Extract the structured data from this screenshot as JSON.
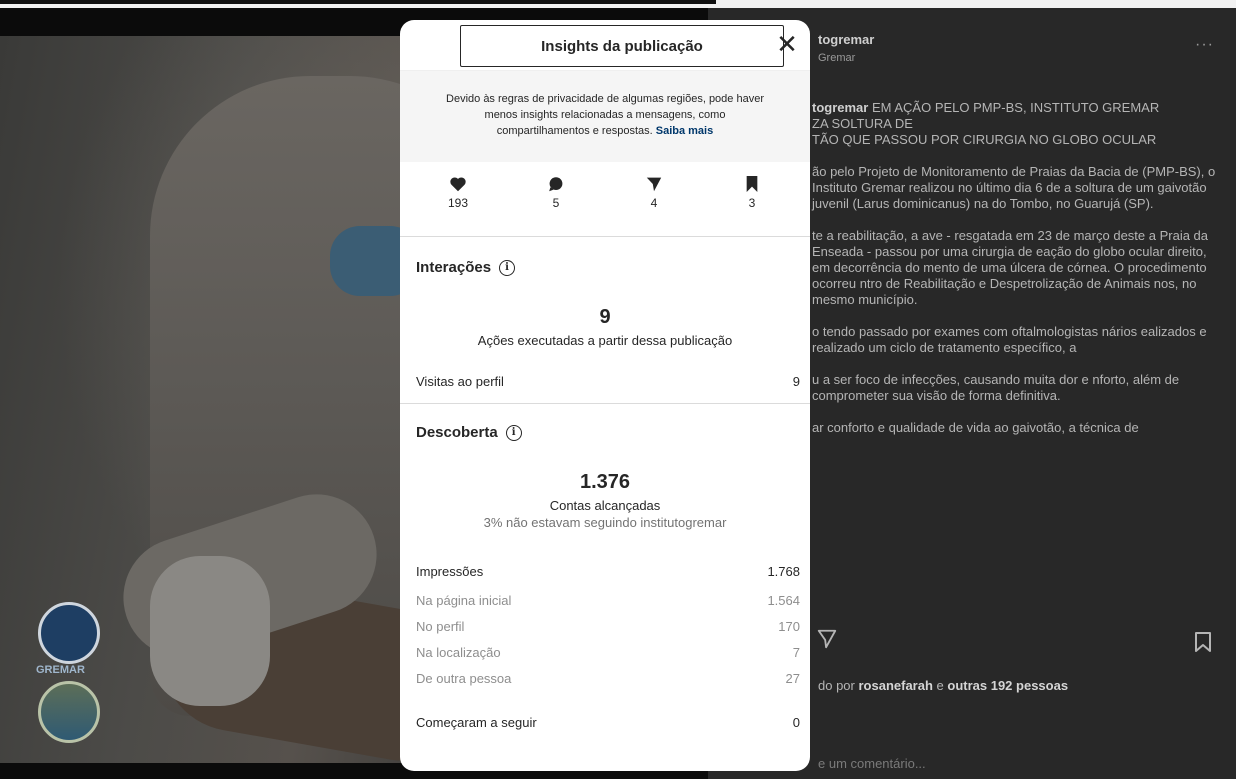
{
  "post": {
    "account": "togremar",
    "subtitle": "Gremar",
    "more_label": "···",
    "caption": {
      "p1_user": "togremar",
      "p1_text": " EM AÇÃO PELO PMP-BS, INSTITUTO GREMAR",
      "p1_l2": "ZA SOLTURA DE",
      "p1_l3": "TÃO QUE PASSOU POR CIRURGIA NO GLOBO OCULAR",
      "p2": "ão pelo Projeto de Monitoramento de Praias da Bacia de (PMP-BS), o Instituto Gremar realizou no último dia 6 de a soltura de um gaivotão juvenil (Larus dominicanus) na do Tombo, no Guarujá (SP).",
      "p3": "te a reabilitação, a ave - resgatada em 23 de março deste a Praia da Enseada - passou por uma cirurgia de eação do globo ocular direito, em decorrência do mento de uma úlcera de córnea. O procedimento ocorreu ntro de Reabilitação e Despetrolização de Animais nos, no mesmo município.",
      "p4": "o tendo passado por exames com oftalmologistas nários ealizados e realizado um ciclo de tratamento específico, a",
      "p5": "u a ser foco de infecções, causando muita dor e nforto, além de comprometer sua visão de forma definitiva.",
      "p6": "ar conforto e qualidade de vida ao gaivotão, a técnica de"
    },
    "likes_prefix": "do por ",
    "likes_user": "rosanefarah",
    "likes_mid": " e ",
    "likes_others": "outras 192 pessoas",
    "comment_placeholder": "e um comentário..."
  },
  "photo": {
    "logo_text": "GREMAR"
  },
  "modal": {
    "title": "Insights da publicação",
    "close_label": "✕",
    "notice_text": "Devido às regras de privacidade de algumas regiões, pode haver menos insights relacionadas a mensagens, como compartilhamentos e respostas. ",
    "notice_link": "Saiba mais",
    "stats": {
      "likes": "193",
      "comments": "5",
      "shares": "4",
      "saves": "3"
    },
    "interactions": {
      "title": "Interações",
      "info": "i",
      "number": "9",
      "label": "Ações executadas a partir dessa publicação",
      "profile_visits_label": "Visitas ao perfil",
      "profile_visits_value": "9"
    },
    "discovery": {
      "title": "Descoberta",
      "info": "i",
      "number": "1.376",
      "label": "Contas alcançadas",
      "sub": "3% não estavam seguindo institutogremar",
      "impressions_label": "Impressões",
      "impressions_value": "1.768",
      "rows": [
        {
          "label": "Na página inicial",
          "value": "1.564"
        },
        {
          "label": "No perfil",
          "value": "170"
        },
        {
          "label": "Na localização",
          "value": "7"
        },
        {
          "label": "De outra pessoa",
          "value": "27"
        }
      ],
      "follows_label": "Começaram a seguir",
      "follows_value": "0"
    }
  },
  "colors": {
    "link": "#00376b",
    "muted": "#8e8e8e"
  }
}
